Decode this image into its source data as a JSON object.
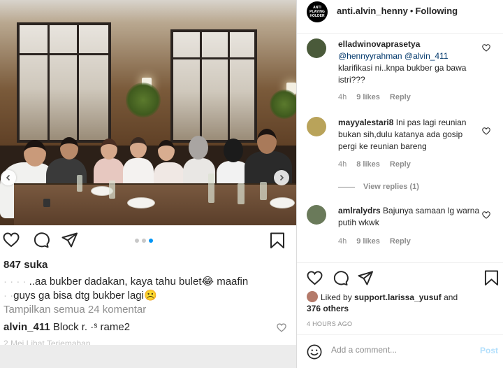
{
  "left_post": {
    "likes": "847 suka",
    "caption_line1_blur": "·  ·  ·  ·  ",
    "caption_line1": "..aa bukber dadakan, kaya tahu bulet😂 maafin",
    "caption_line2_blur": "·  ·",
    "caption_line2": "guys ga bisa dtg bukber lagi☹️",
    "view_all_comments": "Tampilkan semua 24 komentar",
    "comment_user": "alvin_411",
    "comment_text": "Block r.    ·ˢ rame2",
    "faded_row": "2 Mei    Lihat Terjemahan",
    "carousel_active_dot": 3
  },
  "right_panel": {
    "header": {
      "avatar_text": "ANTI PLAYING HOLDER",
      "username": "anti.alvin_henny",
      "separator": "•",
      "follow_state": "Following"
    },
    "comments": [
      {
        "user": "elladwinovaprasetya",
        "mentions": "@hennyyrahman @alvin_411",
        "text": "klarifikasi ni..knpa bukber ga bawa istri???",
        "time": "4h",
        "likes": "9 likes",
        "reply": "Reply",
        "avatar_color": "#4a5a3a"
      },
      {
        "user": "mayyalestari8",
        "text": "Ini pas lagi reunian bukan sih,dulu katanya ada gosip pergi ke reunian bareng",
        "time": "4h",
        "likes": "8 likes",
        "reply": "Reply",
        "avatar_color": "#b9a35a"
      },
      {
        "user": "amlralydrs",
        "text": "Bajunya samaan lg warna putih wkwk",
        "time": "4h",
        "likes": "9 likes",
        "reply": "Reply",
        "avatar_color": "#6a7a5a"
      }
    ],
    "view_replies": "View replies (1)",
    "liked_by_prefix": "Liked by",
    "liked_by_user": "support.larissa_yusuf",
    "liked_by_and": "and",
    "liked_by_others": "376 others",
    "time_ago": "4 HOURS AGO",
    "add_comment_placeholder": "Add a comment...",
    "post_label": "Post"
  },
  "colors": {
    "accent_blue": "#0095f6",
    "post_disabled": "#b2dffc",
    "mention_blue": "#00376b",
    "muted_text": "#8e8e8e"
  }
}
